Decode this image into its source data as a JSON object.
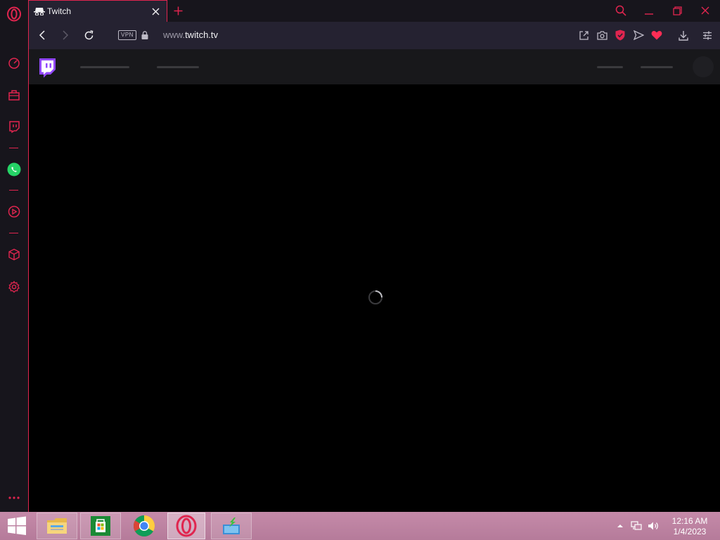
{
  "browser": {
    "tab": {
      "title": "Twitch"
    },
    "address": {
      "vpn_label": "VPN",
      "url_prefix": "www.",
      "url_host": "twitch.tv"
    }
  },
  "sidebar": {
    "items": [
      {
        "icon": "speed-dial-icon"
      },
      {
        "icon": "shopping-bag-icon"
      },
      {
        "icon": "twitch-icon"
      },
      {
        "icon": "whatsapp-icon"
      },
      {
        "icon": "player-icon"
      },
      {
        "icon": "cube-icon"
      },
      {
        "icon": "settings-icon"
      }
    ]
  },
  "taskbar": {
    "apps": [
      "file-explorer-icon",
      "store-icon",
      "chrome-icon",
      "opera-icon",
      "installer-icon"
    ],
    "clock_time": "12:16 AM",
    "clock_date": "1/4/2023"
  },
  "colors": {
    "accent": "#e0254f",
    "twitch_purple": "#9147ff",
    "chrome_bg": "#17151c",
    "toolbar_bg": "#252231",
    "taskbar": "#c58aa9"
  }
}
